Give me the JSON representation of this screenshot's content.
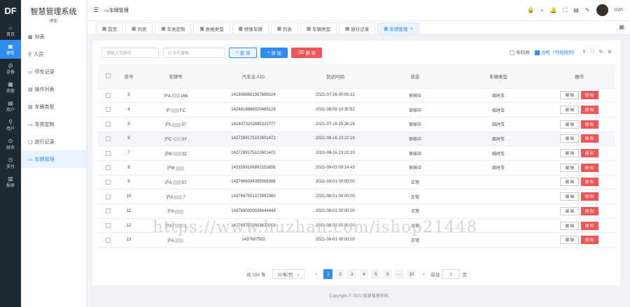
{
  "rail": {
    "logo": "DF",
    "items": [
      {
        "icon": "⌂",
        "label": "首页"
      },
      {
        "icon": "▣",
        "label": "停车"
      },
      {
        "icon": "◎",
        "label": "设备"
      },
      {
        "icon": "▦",
        "label": "商家"
      },
      {
        "icon": "▤",
        "label": "用户"
      },
      {
        "icon": "⚲",
        "label": "用户"
      },
      {
        "icon": "⊙",
        "label": "财务"
      },
      {
        "icon": "◷",
        "label": "支付"
      },
      {
        "icon": "▥",
        "label": "报表"
      }
    ]
  },
  "menu": {
    "title": "智慧管理系统",
    "subtitle": "停车",
    "items": [
      {
        "icon": "▦",
        "label": "列表"
      },
      {
        "icon": "⚲",
        "label": "人员"
      },
      {
        "icon": "▭",
        "label": "停车记录"
      },
      {
        "icon": "▤",
        "label": "操作列表"
      },
      {
        "icon": "▤",
        "label": "车辆类型"
      },
      {
        "icon": "▭",
        "label": "车类定制"
      },
      {
        "icon": "▢",
        "label": "放行记录"
      },
      {
        "icon": "▭",
        "label": "车牌管理"
      }
    ]
  },
  "topbar": {
    "breadcrumb": "车牌管理",
    "icons": [
      "🔒",
      "⌕",
      "🔔",
      "⛶",
      "▤",
      "✎"
    ],
    "user": "clzh"
  },
  "tabs": [
    {
      "label": "首页"
    },
    {
      "label": "列表"
    },
    {
      "label": "车类定制"
    },
    {
      "label": "表格类型"
    },
    {
      "label": "特殊车辆"
    },
    {
      "label": "列表"
    },
    {
      "label": "车辆类型"
    },
    {
      "label": "放行记录"
    },
    {
      "label": "车牌管理"
    }
  ],
  "toolbar": {
    "plate_placeholder": "请输入车牌号",
    "ic_placeholder": "IC卡号搜索",
    "search_label": "查 询",
    "add_label": "添 加",
    "delete_label": "删 除",
    "opt1": "条码格",
    "opt2": "边框（可拖拽列）"
  },
  "table": {
    "headers": [
      "序号",
      "车牌号",
      "汽车主人ID",
      "到达时间",
      "状态",
      "车辆类型",
      "操作"
    ],
    "edit_label": "编 辑",
    "del_label": "删 除",
    "rows": [
      {
        "no": "5",
        "plate_a": "沪A",
        "plate_b": "168",
        "owner": "1418086681357888024",
        "time": "2021-07-26 00:00:21",
        "status": "审核中",
        "type": "临时车",
        "hl": false
      },
      {
        "no": "4",
        "plate_a": "沪",
        "plate_b": "FC",
        "owner": "1424618886020485129",
        "time": "2021-08-09 14:30:52",
        "status": "审核中",
        "type": "临时车",
        "hl": false
      },
      {
        "no": "5",
        "plate_a": "沪L",
        "plate_b": "57",
        "owner": "1416073202885323777",
        "time": "2021-07-16 19:36:29",
        "status": "审核中",
        "type": "临时车",
        "hl": false
      },
      {
        "no": "6",
        "plate_a": "沪C",
        "plate_b": "3Y",
        "owner": "1427289175102601472",
        "time": "2021-08-16 23:22:16",
        "status": "审核中",
        "type": "临时车",
        "hl": true
      },
      {
        "no": "7",
        "plate_a": "沪B",
        "plate_b": "32",
        "owner": "1427289175102601472",
        "time": "2021-08-16 23:23:20",
        "status": "审核中",
        "type": "临时车",
        "hl": false
      },
      {
        "no": "8",
        "plate_a": "沪M",
        "plate_b": "",
        "owner": "1433599106892153856",
        "time": "2021-09-03 09:14:43",
        "status": "审核中",
        "type": "临时车",
        "hl": false
      },
      {
        "no": "9",
        "plate_a": "沪A",
        "plate_b": "57",
        "owner": "1437666594395066368",
        "time": "2021-08-01 00:00:00",
        "status": "正常",
        "type": "",
        "hl": false
      },
      {
        "no": "10",
        "plate_a": "沪A",
        "plate_b": "7",
        "owner": "1437697501373992960",
        "time": "2021-08-01 00:00:00",
        "status": "正常",
        "type": "",
        "hl": false
      },
      {
        "no": "11",
        "plate_a": "沪A",
        "plate_b": "",
        "owner": "1437690000028444444",
        "time": "2021-08-01 00:00:00",
        "status": "正常",
        "type": "",
        "hl": false
      },
      {
        "no": "12",
        "plate_a": "沪A7",
        "plate_b": "1",
        "owner": "1437697502943630016",
        "time": "2021-08-01 00:00:00",
        "status": "正常",
        "type": "",
        "hl": false
      },
      {
        "no": "13",
        "plate_a": "沪A",
        "plate_b": "",
        "owner": "1437697503",
        "time": "2021-08-01 00:00:00",
        "status": "正常",
        "type": "",
        "hl": false
      }
    ]
  },
  "pager": {
    "total": "共 150 条",
    "size": "20条/页",
    "pages": [
      "1",
      "2",
      "3",
      "4",
      "5",
      "6",
      "···",
      "10"
    ],
    "current": "1",
    "jump_label": "前往",
    "jump_value": "1",
    "page_suffix": "页"
  },
  "footer": "Copyright © 2022 智慧管理系统",
  "watermark": "https://www.huzhan.com/ishop21448",
  "colors": {
    "primary": "#2f8cf3",
    "danger": "#f05454",
    "rail": "#1e2933"
  }
}
